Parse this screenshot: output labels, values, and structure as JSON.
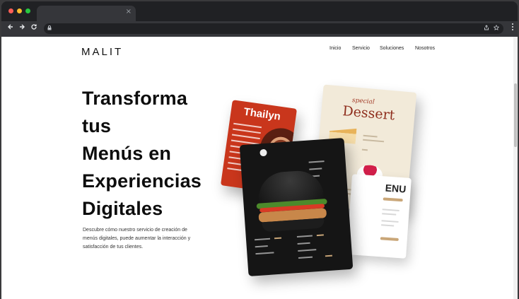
{
  "browser": {
    "tab_close": "×",
    "icons": {
      "back": "back-arrow-icon",
      "forward": "forward-arrow-icon",
      "reload": "reload-icon",
      "lock": "lock-icon",
      "share": "share-icon",
      "bookmark": "star-icon",
      "menu": "kebab-menu-icon"
    }
  },
  "site": {
    "logo": "MALIT",
    "nav": [
      {
        "label": "Inicio"
      },
      {
        "label": "Servicio"
      },
      {
        "label": "Soluciones"
      },
      {
        "label": "Nosotros"
      }
    ]
  },
  "hero": {
    "title_lines": [
      "Transforma",
      "tus",
      "Menús en",
      "Experiencias",
      "Digitales"
    ],
    "description_lines": [
      "Descubre cómo nuestro servicio de creación de",
      "menús digitales, puede aumentar la interacción y",
      "satisfacción de tus clientes."
    ]
  },
  "cards": {
    "thai_title": "Thailyn",
    "dessert_special": "special",
    "dessert_title": "Dessert",
    "menu_word": "ENU"
  },
  "colors": {
    "thai": "#c9361c",
    "dessert": "#f2ead9",
    "burger": "#151515",
    "accent_gold": "#c9a678"
  }
}
